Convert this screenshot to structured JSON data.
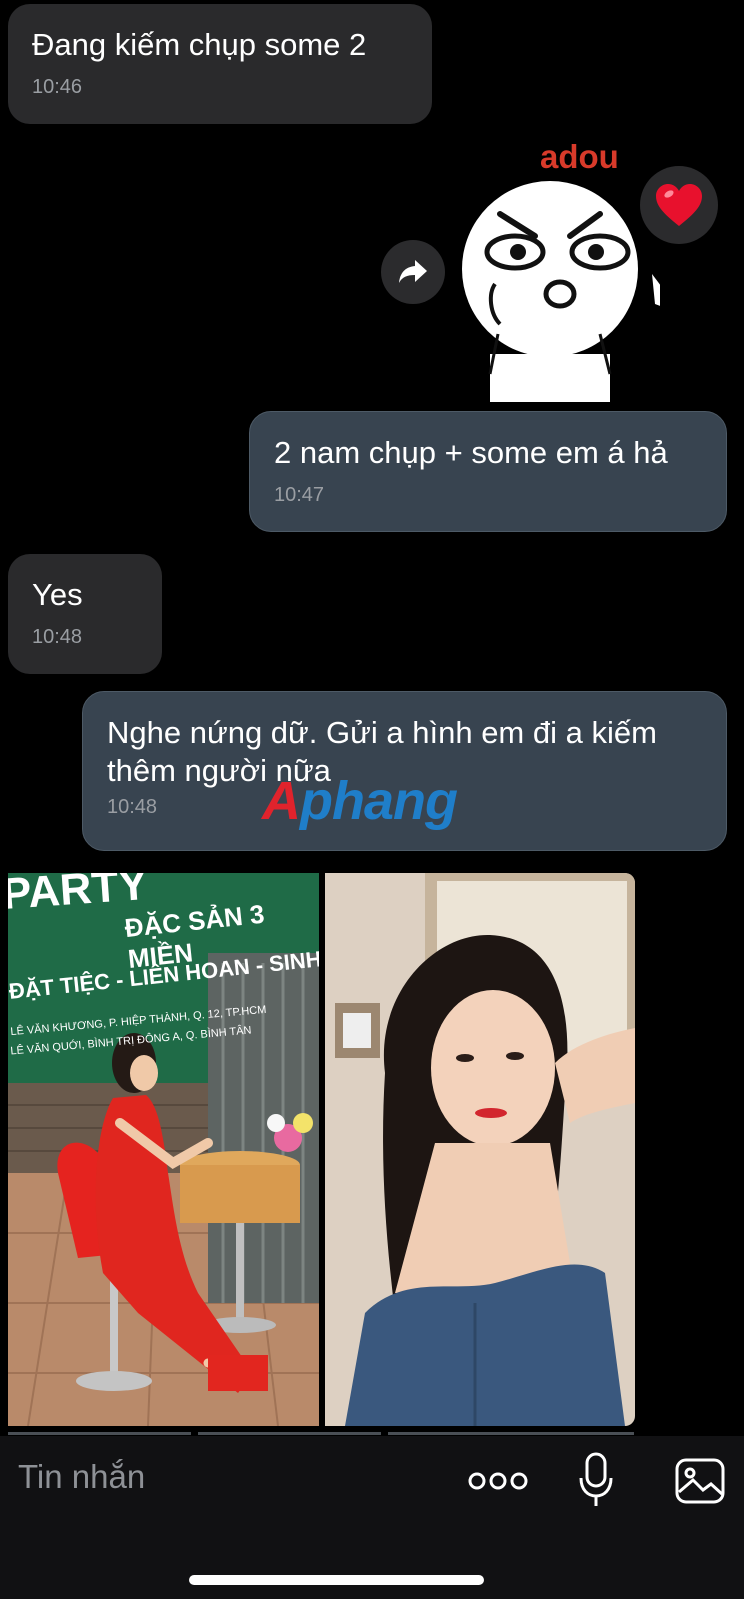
{
  "messages": [
    {
      "direction": "in",
      "text": "Đang kiếm chụp some 2",
      "time": "10:46"
    },
    {
      "direction": "in",
      "type": "sticker",
      "caption": "adou",
      "reaction": "heart"
    },
    {
      "direction": "out",
      "text": "2 nam chụp + some em á hả",
      "time": "10:47"
    },
    {
      "direction": "in",
      "text": "Yes",
      "time": "10:48"
    },
    {
      "direction": "out",
      "text": "Nghe nứng dữ. Gửi a hình em đi a kiếm\nthêm người nữa",
      "time": "10:48"
    }
  ],
  "photos": {
    "photo_1": {
      "sign_line_1": "PARTY",
      "sign_line_2": "ĐẶC SẢN 3 MIỀN",
      "sign_line_3": "ĐẶT TIỆC - LIÊN HOAN - SINH NHẬT",
      "sign_line_4": "LÊ VĂN KHƯƠNG, P. HIỆP THÀNH, Q. 12, TP.HCM",
      "sign_line_5": "LÊ VĂN QUỚI, BÌNH TRỊ ĐÔNG A, Q. BÌNH TÂN"
    }
  },
  "watermark": {
    "a": "A",
    "rest": "phang"
  },
  "composer": {
    "placeholder": "Tin nhắn"
  },
  "icons": {
    "forward": "forward-arrow-icon",
    "reaction": "heart-icon",
    "more": "more-dots-icon",
    "mic": "microphone-icon",
    "image": "image-icon"
  },
  "colors": {
    "incoming_bubble": "#2a2a2c",
    "outgoing_bubble": "#384450",
    "sticker_caption": "#d83a2a"
  }
}
